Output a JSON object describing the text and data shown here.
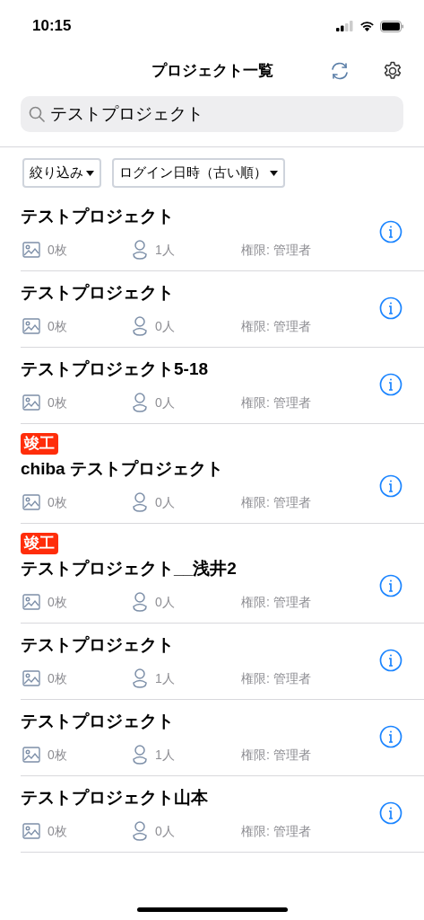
{
  "status_bar": {
    "time": "10:15"
  },
  "header": {
    "title": "プロジェクト一覧"
  },
  "search": {
    "value": "テストプロジェクト"
  },
  "filters": [
    {
      "label": "絞り込み"
    },
    {
      "label": "ログイン日時（古い順）"
    }
  ],
  "projects": [
    {
      "name": "テストプロジェクト",
      "photos": "0枚",
      "members": "1人",
      "role": "権限: 管理者"
    },
    {
      "name": "テストプロジェクト",
      "photos": "0枚",
      "members": "0人",
      "role": "権限: 管理者"
    },
    {
      "name": "テストプロジェクト5-18",
      "photos": "0枚",
      "members": "0人",
      "role": "権限: 管理者"
    },
    {
      "badge": "竣工",
      "name": "chiba テストプロジェクト",
      "photos": "0枚",
      "members": "0人",
      "role": "権限: 管理者"
    },
    {
      "badge": "竣工",
      "name": "テストプロジェクト__浅井2",
      "photos": "0枚",
      "members": "0人",
      "role": "権限: 管理者"
    },
    {
      "name": "テストプロジェクト",
      "photos": "0枚",
      "members": "1人",
      "role": "権限: 管理者"
    },
    {
      "name": "テストプロジェクト",
      "photos": "0枚",
      "members": "1人",
      "role": "権限: 管理者"
    },
    {
      "name": "テストプロジェクト山本",
      "photos": "0枚",
      "members": "0人",
      "role": "権限: 管理者"
    }
  ]
}
